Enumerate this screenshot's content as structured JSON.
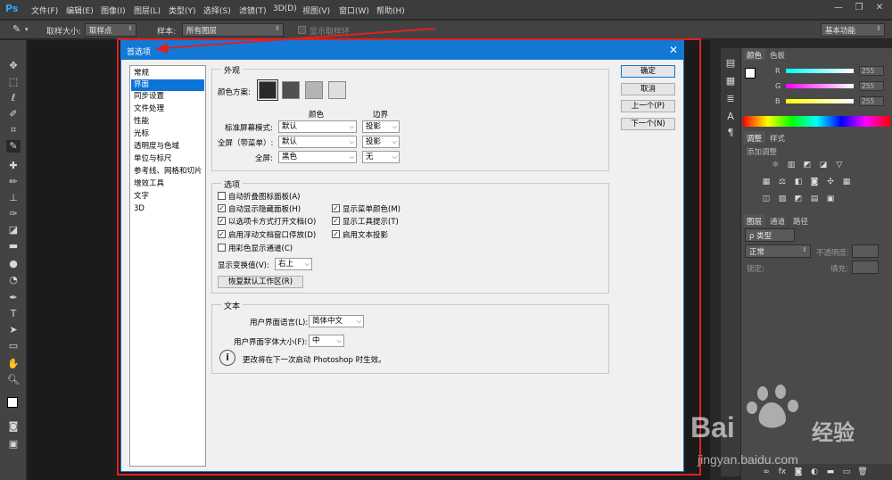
{
  "menubar": {
    "logo": "Ps",
    "items": [
      "文件(F)",
      "编辑(E)",
      "图像(I)",
      "图层(L)",
      "类型(Y)",
      "选择(S)",
      "滤镜(T)",
      "3D(D)",
      "视图(V)",
      "窗口(W)",
      "帮助(H)"
    ]
  },
  "optbar": {
    "sample_size_label": "取样大小:",
    "sample_size_value": "取样点",
    "sample_label": "样本:",
    "sample_value": "所有图层",
    "show_ring_label": "显示取样环",
    "workspace_value": "基本功能"
  },
  "panels": {
    "color_tabs": [
      "颜色",
      "色板"
    ],
    "sliders": [
      {
        "label": "R",
        "value": "255",
        "color": "#00ffff"
      },
      {
        "label": "G",
        "value": "255",
        "color": "#ff00ff"
      },
      {
        "label": "B",
        "value": "255",
        "color": "#ffff00"
      }
    ],
    "adjust_tabs": [
      "调整",
      "样式"
    ],
    "adjust_add_label": "添加调整",
    "layers_tabs": [
      "图层",
      "通道",
      "路径"
    ],
    "layers_kind": "ρ 类型",
    "blend_mode": "正常",
    "opacity_label": "不透明度:",
    "lock_label": "锁定:",
    "fill_label": "填充:"
  },
  "dialog": {
    "title": "首选项",
    "categories": [
      "常规",
      "界面",
      "同步设置",
      "文件处理",
      "性能",
      "光标",
      "透明度与色域",
      "单位与标尺",
      "参考线、网格和切片",
      "增效工具",
      "文字",
      "3D"
    ],
    "selected_index": 1,
    "appearance": {
      "title": "外观",
      "scheme_label": "颜色方案:",
      "swatches": [
        "#2a2a2a",
        "#505050",
        "#b4b4b4",
        "#dedede"
      ],
      "col_color": "颜色",
      "col_border": "边界",
      "rows": [
        {
          "label": "标准屏幕模式:",
          "color": "默认",
          "border": "投影"
        },
        {
          "label": "全屏（带菜单）:",
          "color": "默认",
          "border": "投影"
        },
        {
          "label": "全屏:",
          "color": "黑色",
          "border": "无"
        }
      ]
    },
    "options": {
      "title": "选项",
      "checks_left": [
        {
          "label": "自动折叠图标面板(A)",
          "checked": false
        },
        {
          "label": "自动显示隐藏面板(H)",
          "checked": true
        },
        {
          "label": "以选项卡方式打开文档(O)",
          "checked": true
        },
        {
          "label": "启用浮动文档窗口停放(D)",
          "checked": true
        },
        {
          "label": "用彩色显示通道(C)",
          "checked": false
        }
      ],
      "checks_right": [
        {
          "label": "显示菜单颜色(M)",
          "checked": true
        },
        {
          "label": "显示工具提示(T)",
          "checked": true
        },
        {
          "label": "启用文本投影",
          "checked": true
        }
      ],
      "transform_label": "显示变换值(V):",
      "transform_value": "右上",
      "restore_label": "恢复默认工作区(R)"
    },
    "text": {
      "title": "文本",
      "lang_label": "用户界面语言(L):",
      "lang_value": "简体中文",
      "size_label": "用户界面字体大小(F):",
      "size_value": "中",
      "info_text": "更改将在下一次启动 Photoshop 时生效。"
    },
    "buttons": {
      "ok": "确定",
      "cancel": "取消",
      "prev": "上一个(P)",
      "next": "下一个(N)"
    }
  },
  "watermark": {
    "brand": "Bai",
    "brand2": "经验",
    "url": "jingyan.baidu.com"
  }
}
